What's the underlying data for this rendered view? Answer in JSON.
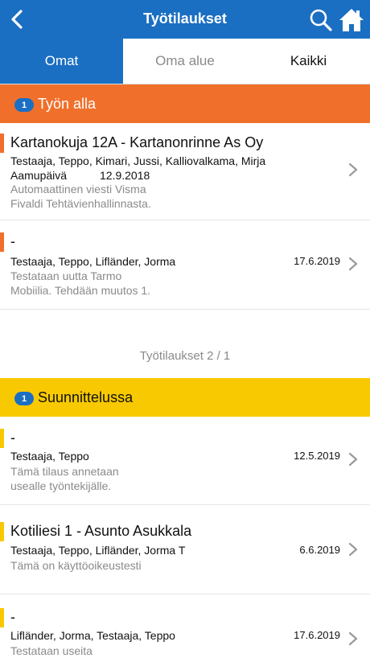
{
  "navbar": {
    "title": "Työtilaukset",
    "back_icon": "chevron-left-icon",
    "search_icon": "search-icon",
    "home_icon": "home-icon",
    "color": "#1b6fc2"
  },
  "tabs": [
    {
      "label": "Omat",
      "active": true
    },
    {
      "label": "Oma alue",
      "active": false
    },
    {
      "label": "Kaikki",
      "active": false
    }
  ],
  "sections": [
    {
      "badge": "1",
      "title": "Työn alla",
      "color": "#f0702b",
      "items": [
        {
          "title": "Kartanokuja 12A - Kartanonrinne As Oy",
          "people": "Testaaja, Teppo, Kimari, Jussi, Kalliovalkama, Mirja",
          "due_label": "Aamupäivä",
          "due_date": "12.9.2018",
          "desc_line1": "Automaattinen viesti Visma",
          "desc_line2": "Fivaldi Tehtävienhallinnasta."
        },
        {
          "title": "-",
          "people": "Testaaja, Teppo, Lifländer, Jorma",
          "date": "17.6.2019",
          "desc_line1": "Testataan uutta Tarmo",
          "desc_line2": "Mobiilia. Tehdään muutos 1."
        }
      ],
      "pager": "Työtilaukset 2 / 1"
    },
    {
      "badge": "1",
      "title": "Suunnittelussa",
      "color": "#f8c900",
      "items": [
        {
          "title": "-",
          "people": "Testaaja, Teppo",
          "date": "12.5.2019",
          "desc_line1": "Tämä tilaus annetaan",
          "desc_line2": "usealle työntekijälle."
        },
        {
          "title": "Kotiliesi 1 - Asunto Asukkala",
          "people": "Testaaja, Teppo, Lifländer, Jorma T",
          "date": "6.6.2019",
          "desc_line1": "Tämä on käyttöoikeustesti"
        },
        {
          "title": "-",
          "people": "Lifländer, Jorma, Testaaja, Teppo",
          "date": "17.6.2019",
          "desc_line1": "Testataan useita"
        }
      ]
    }
  ]
}
